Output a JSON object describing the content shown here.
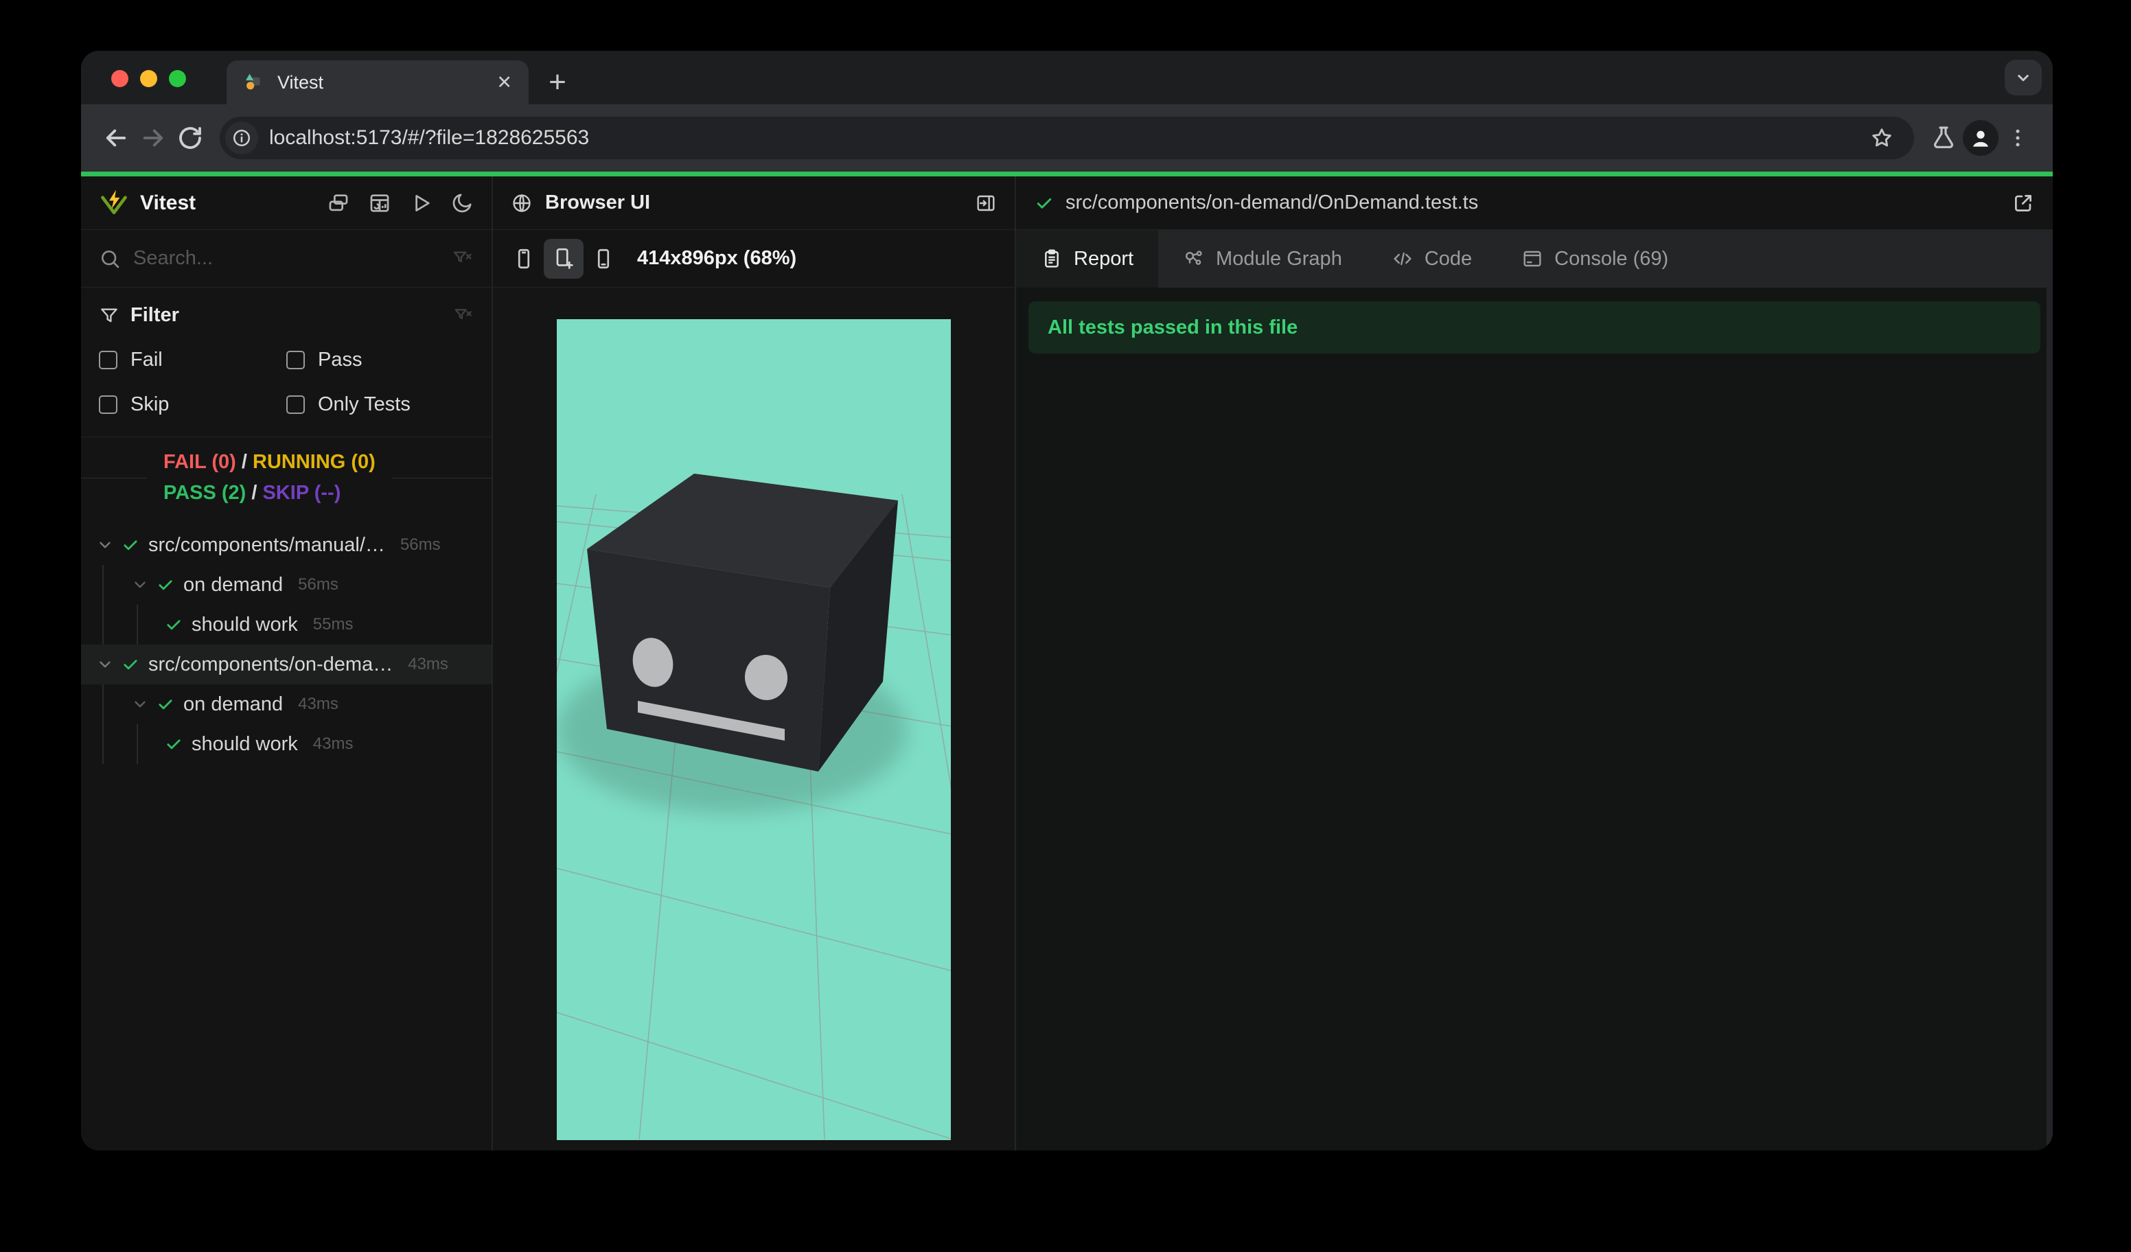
{
  "browser": {
    "tab_title": "Vitest",
    "close_glyph": "✕",
    "newtab_glyph": "+",
    "url": "localhost:5173/#/?file=1828625563"
  },
  "sidebar": {
    "title": "Vitest",
    "search_placeholder": "Search...",
    "filter": {
      "label": "Filter",
      "options": [
        "Fail",
        "Pass",
        "Skip",
        "Only Tests"
      ]
    },
    "summary": {
      "fail": "FAIL (0)",
      "running": "RUNNING (0)",
      "pass": "PASS (2)",
      "skip": "SKIP (--)",
      "sep": "/"
    },
    "tree": {
      "files": [
        {
          "name": "src/components/manual/…",
          "duration": "56ms",
          "suite": {
            "name": "on demand",
            "duration": "56ms",
            "test": {
              "name": "should work",
              "duration": "55ms"
            }
          }
        },
        {
          "name": "src/components/on-dema…",
          "duration": "43ms",
          "suite": {
            "name": "on demand",
            "duration": "43ms",
            "test": {
              "name": "should work",
              "duration": "43ms"
            }
          }
        }
      ]
    }
  },
  "browser_panel": {
    "title": "Browser UI",
    "resolution": "414x896px (68%)"
  },
  "report_panel": {
    "file_path": "src/components/on-demand/OnDemand.test.ts",
    "tabs": [
      {
        "label": "Report",
        "active": true
      },
      {
        "label": "Module Graph",
        "active": false
      },
      {
        "label": "Code",
        "active": false
      },
      {
        "label": "Console (69)",
        "active": false
      }
    ],
    "banner": "All tests passed in this file"
  },
  "colors": {
    "accent_green": "#2fc057",
    "pass_green": "#2fbe61",
    "fail_red": "#f25c5c",
    "running_yellow": "#e2b30a",
    "skip_purple": "#7440c0",
    "banner_bg": "#15291d",
    "viewport_teal": "#7eddc5",
    "chrome_bg": "#2f3134",
    "panel_bg": "#141414"
  }
}
